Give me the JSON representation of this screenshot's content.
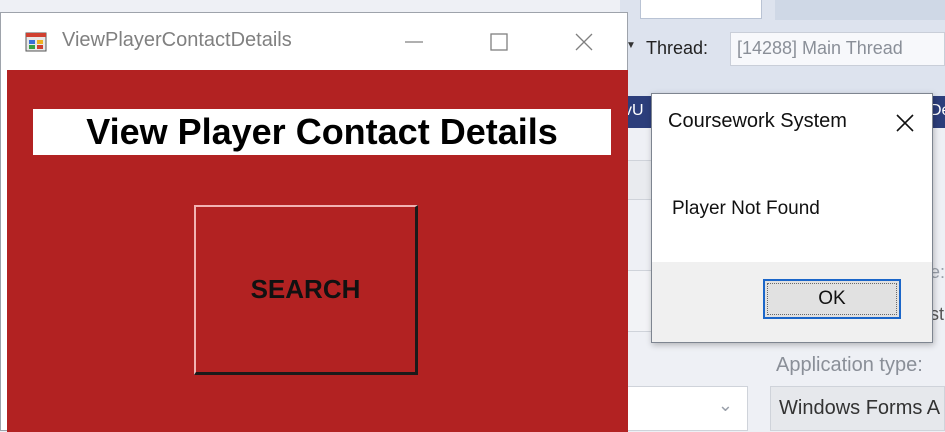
{
  "background_ide": {
    "thread_label": "Thread:",
    "thread_value": "[14288] Main Thread",
    "blue_bar_left": "vU",
    "blue_bar_right": "De",
    "side_text_1": "e:",
    "side_text_2": "st",
    "application_type_label": "Application type:",
    "application_type_value": "Windows Forms A"
  },
  "main_window": {
    "title": "ViewPlayerContactDetails",
    "heading": "View Player Contact Details",
    "search_button_label": "SEARCH",
    "form_color": "#b22222"
  },
  "message_box": {
    "title": "Coursework System",
    "message": "Player Not Found",
    "ok_label": "OK",
    "accent_color": "#1b66c9"
  }
}
